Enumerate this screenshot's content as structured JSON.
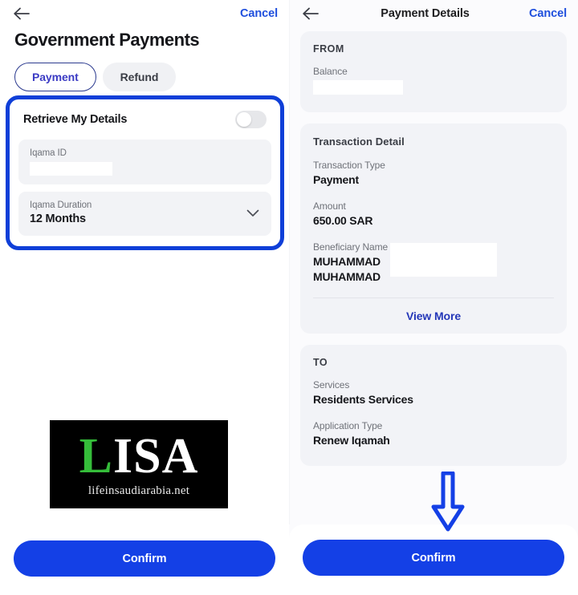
{
  "left_screen": {
    "nav": {
      "back_icon": "arrow-left-icon",
      "cancel_label": "Cancel"
    },
    "page_title": "Government Payments",
    "segments": [
      {
        "label": "Payment",
        "selected": true
      },
      {
        "label": "Refund",
        "selected": false
      }
    ],
    "retrieve_card": {
      "title": "Retrieve My Details",
      "toggle": {
        "name": "retrieve-my-details-toggle",
        "state": "off"
      },
      "fields": [
        {
          "label": "Iqama ID",
          "value": "",
          "redacted": true,
          "type": "text-input"
        },
        {
          "label": "Iqama Duration",
          "value": "12 Months",
          "redacted": false,
          "type": "dropdown",
          "chevron_icon": "chevron-down-icon"
        }
      ],
      "highlight_color": "#0f3fd8"
    },
    "watermark": {
      "brand_first": "L",
      "brand_rest": "ISA",
      "tagline": "lifeinsaudiarabia.net",
      "bg_color": "#000000",
      "accent_color": "#35bd3a"
    },
    "confirm_label": "Confirm"
  },
  "right_screen": {
    "nav": {
      "back_icon": "arrow-left-icon",
      "title": "Payment Details",
      "cancel_label": "Cancel"
    },
    "from_card": {
      "heading": "FROM",
      "rows": [
        {
          "label": "Balance",
          "value": "",
          "redacted": true
        }
      ]
    },
    "transaction_card": {
      "heading": "Transaction Detail",
      "rows": [
        {
          "label": "Transaction Type",
          "value": "Payment",
          "redacted": false
        },
        {
          "label": "Amount",
          "value": "650.00 SAR",
          "redacted": false
        },
        {
          "label": "Beneficiary Name",
          "value": "MUHAMMAD MUHAMMAD",
          "redacted": true
        }
      ],
      "view_more_label": "View More"
    },
    "to_card": {
      "heading": "TO",
      "rows": [
        {
          "label": "Services",
          "value": "Residents Services",
          "redacted": false
        },
        {
          "label": "Application Type",
          "value": "Renew Iqamah",
          "redacted": false
        }
      ]
    },
    "confirm_label": "Confirm",
    "annotation": {
      "name": "down-arrow-annotation-icon",
      "color": "#1440e6",
      "points_to": "confirm-button"
    }
  },
  "theme": {
    "primary_blue": "#1440e6",
    "link_blue": "#1f4fdd",
    "highlight_blue": "#0f3fd8",
    "card_bg": "#f2f3f7",
    "panel_bg": "#fbfbfd",
    "text_dark": "#15161a",
    "text_muted": "#6f7279"
  }
}
